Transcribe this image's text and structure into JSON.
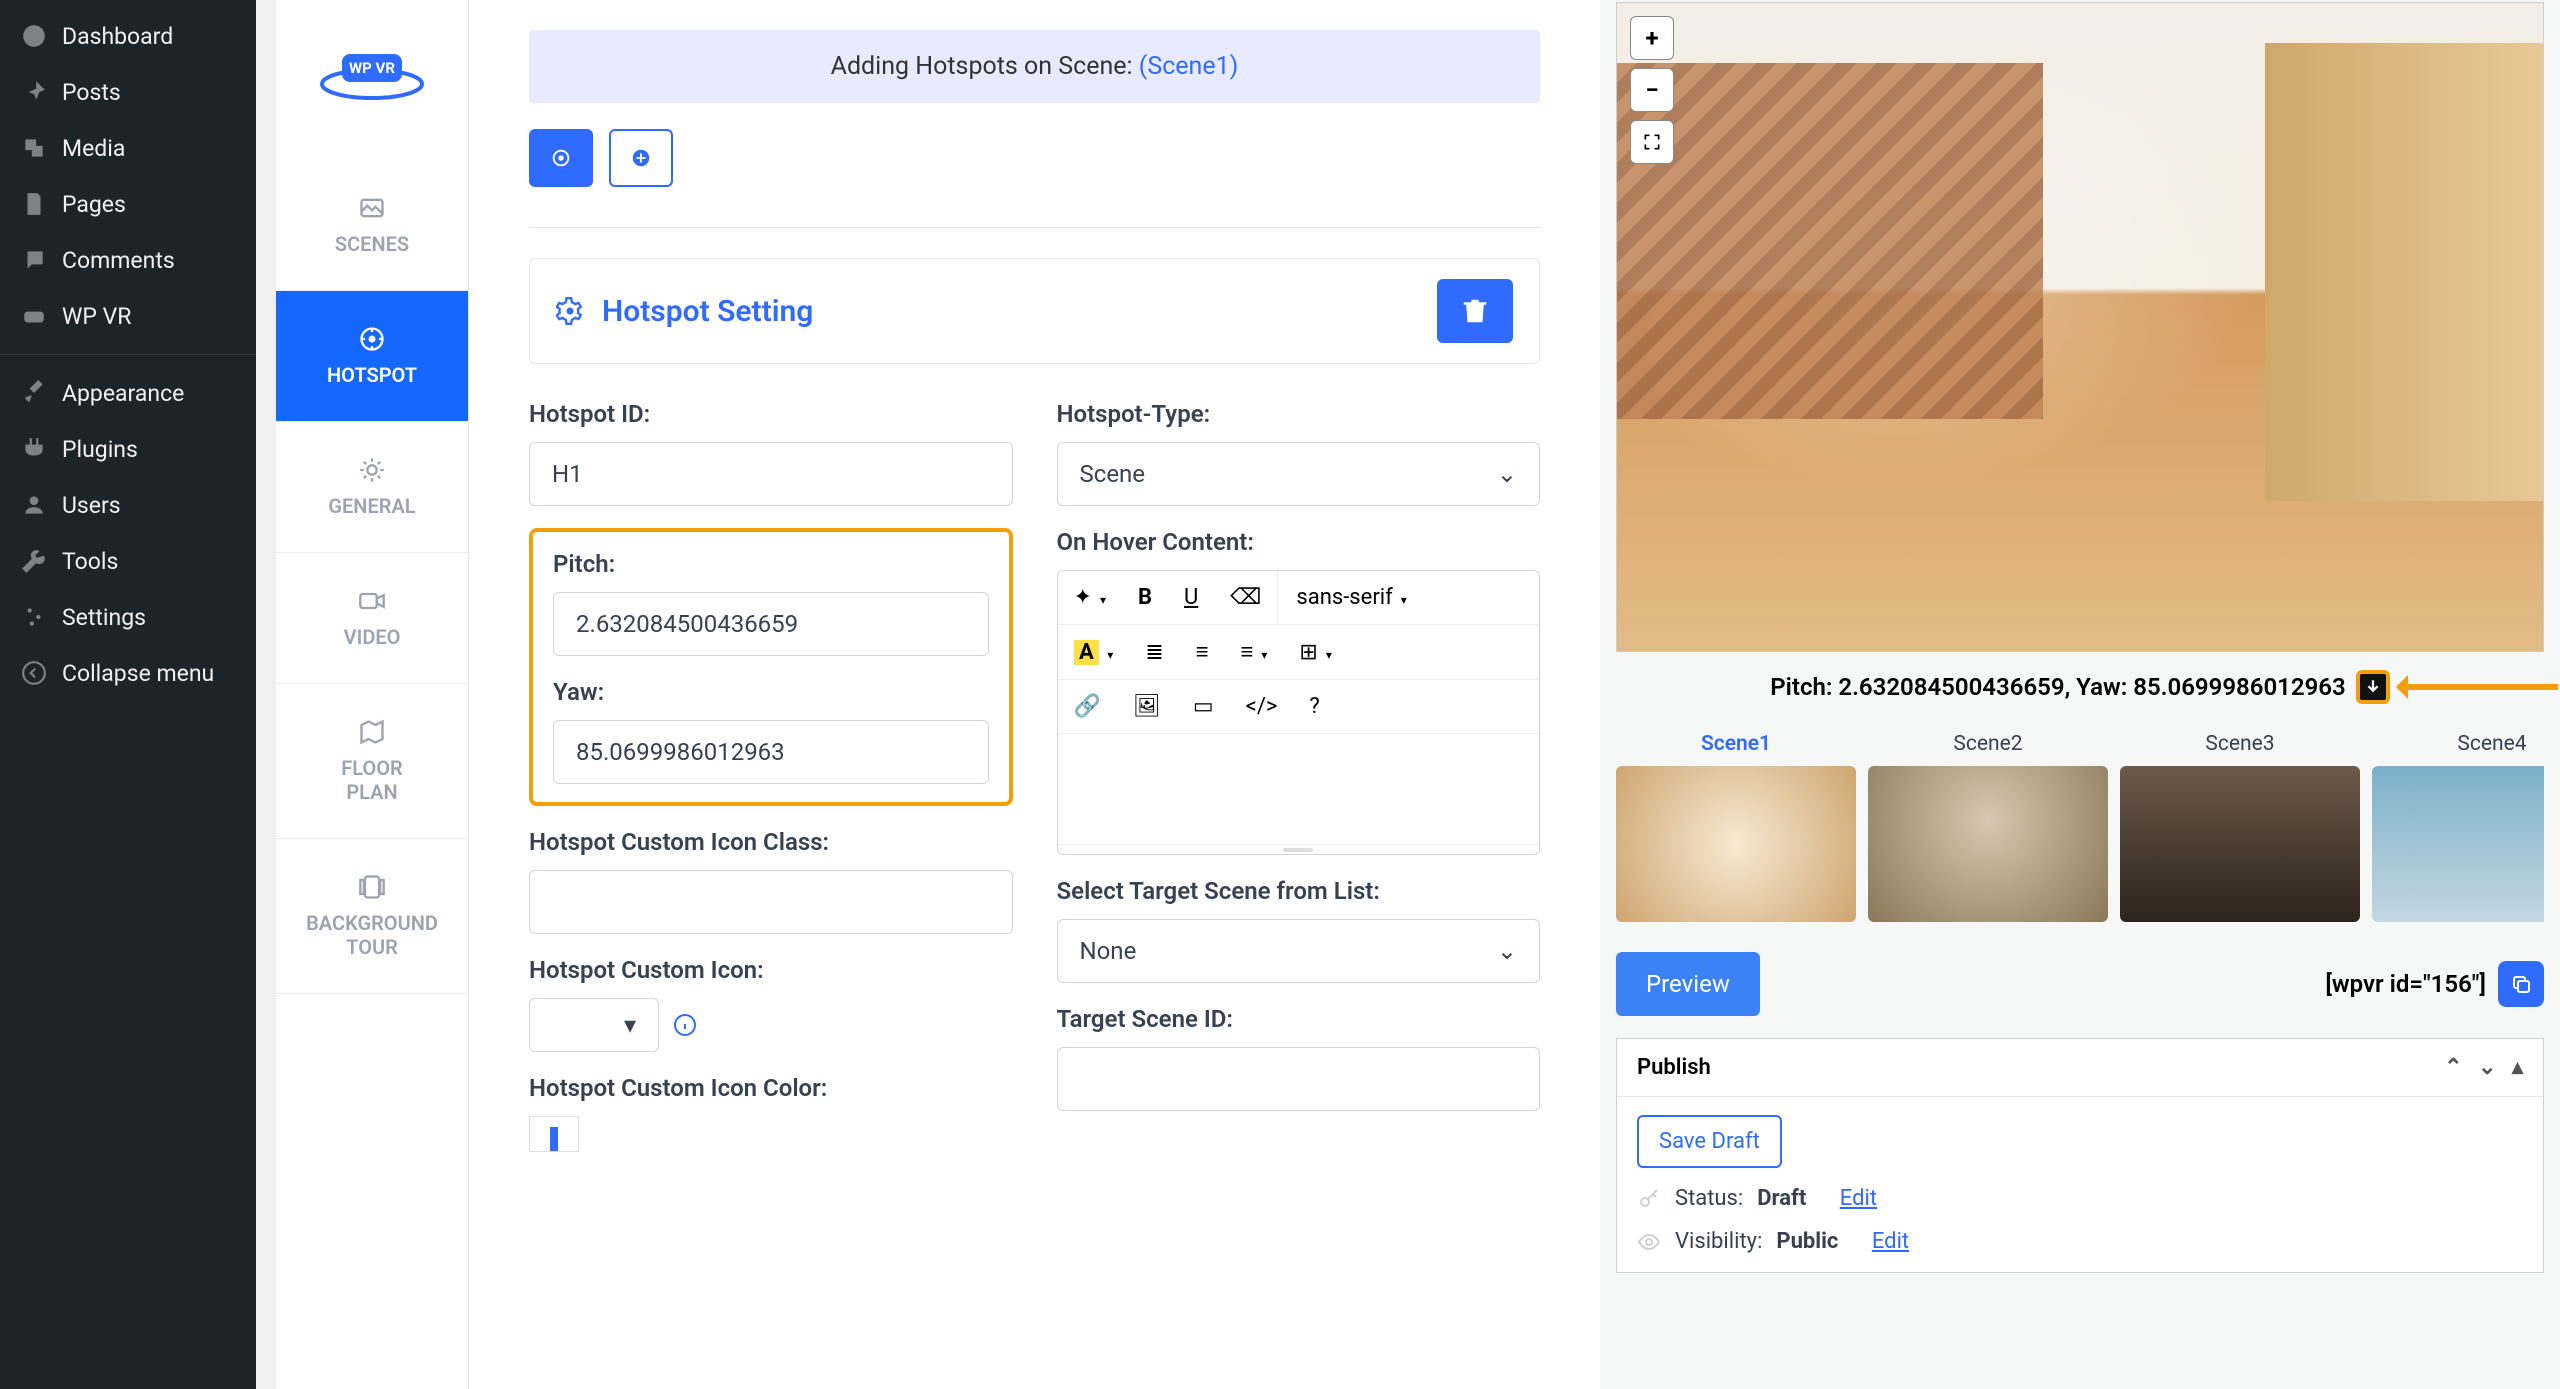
{
  "wp_menu": {
    "dashboard": "Dashboard",
    "posts": "Posts",
    "media": "Media",
    "pages": "Pages",
    "comments": "Comments",
    "wpvr": "WP VR",
    "appearance": "Appearance",
    "plugins": "Plugins",
    "users": "Users",
    "tools": "Tools",
    "settings": "Settings",
    "collapse": "Collapse menu"
  },
  "vtabs": {
    "scenes": "SCENES",
    "hotspot": "HOTSPOT",
    "general": "GENERAL",
    "video": "VIDEO",
    "floorplan_l1": "FLOOR",
    "floorplan_l2": "PLAN",
    "bgtour_l1": "BACKGROUND",
    "bgtour_l2": "TOUR"
  },
  "banner": {
    "prefix": "Adding Hotspots on Scene: ",
    "scene": "(Scene1)"
  },
  "panel_title": "Hotspot Setting",
  "hotspot": {
    "id_label": "Hotspot ID:",
    "id_value": "H1",
    "type_label": "Hotspot-Type:",
    "type_value": "Scene",
    "pitch_label": "Pitch:",
    "pitch_value": "2.632084500436659",
    "yaw_label": "Yaw:",
    "yaw_value": "85.0699986012963",
    "icon_class_label": "Hotspot Custom Icon Class:",
    "icon_label": "Hotspot Custom Icon:",
    "icon_color_label": "Hotspot Custom Icon Color:",
    "hover_label": "On Hover Content:",
    "font_label": "sans-serif",
    "target_list_label": "Select Target Scene from List:",
    "target_list_value": "None",
    "target_id_label": "Target Scene ID:"
  },
  "preview": {
    "coord_text": "Pitch: 2.632084500436659, Yaw: 85.0699986012963",
    "scenes": [
      "Scene1",
      "Scene2",
      "Scene3",
      "Scene4"
    ],
    "preview_btn": "Preview",
    "shortcode": "[wpvr id=\"156\"]"
  },
  "publish": {
    "title": "Publish",
    "save_draft": "Save Draft",
    "status_label": "Status: ",
    "status_value": "Draft",
    "visibility_label": "Visibility: ",
    "visibility_value": "Public",
    "edit": "Edit"
  }
}
